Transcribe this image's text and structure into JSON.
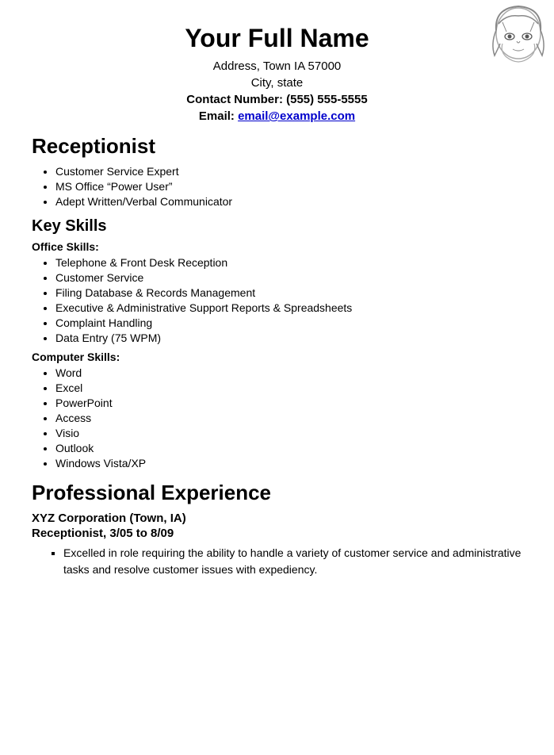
{
  "header": {
    "name": "Your Full Name",
    "address": "Address, Town IA 57000",
    "city": "City, state",
    "contact_label": "Contact Number:",
    "contact_number": "(555) 555-5555",
    "email_label": "Email:",
    "email": "email@example.com"
  },
  "section_receptionist": {
    "title": "Receptionist",
    "bullets": [
      "Customer Service Expert",
      "MS Office “Power User”",
      "Adept Written/Verbal Communicator"
    ]
  },
  "section_keyskills": {
    "title": "Key Skills",
    "office_skills_label": "Office  Skills:",
    "office_skills": [
      "Telephone & Front Desk Reception",
      "Customer Service",
      "Filing Database & Records Management",
      "Executive & Administrative Support Reports & Spreadsheets",
      "Complaint Handling",
      "Data Entry (75 WPM)"
    ],
    "computer_skills_label": "Computer  Skills:",
    "computer_skills": [
      "Word",
      "Excel",
      "PowerPoint",
      "Access",
      "Visio",
      "Outlook",
      "Windows Vista/XP"
    ]
  },
  "section_experience": {
    "title": "Professional Experience",
    "company": "XYZ Corporation (Town, IA)",
    "job_title": "Receptionist, 3/05 to 8/09",
    "bullets": [
      "Excelled in role requiring the ability to handle a variety of customer service and administrative tasks and resolve customer issues  with expediency."
    ]
  }
}
